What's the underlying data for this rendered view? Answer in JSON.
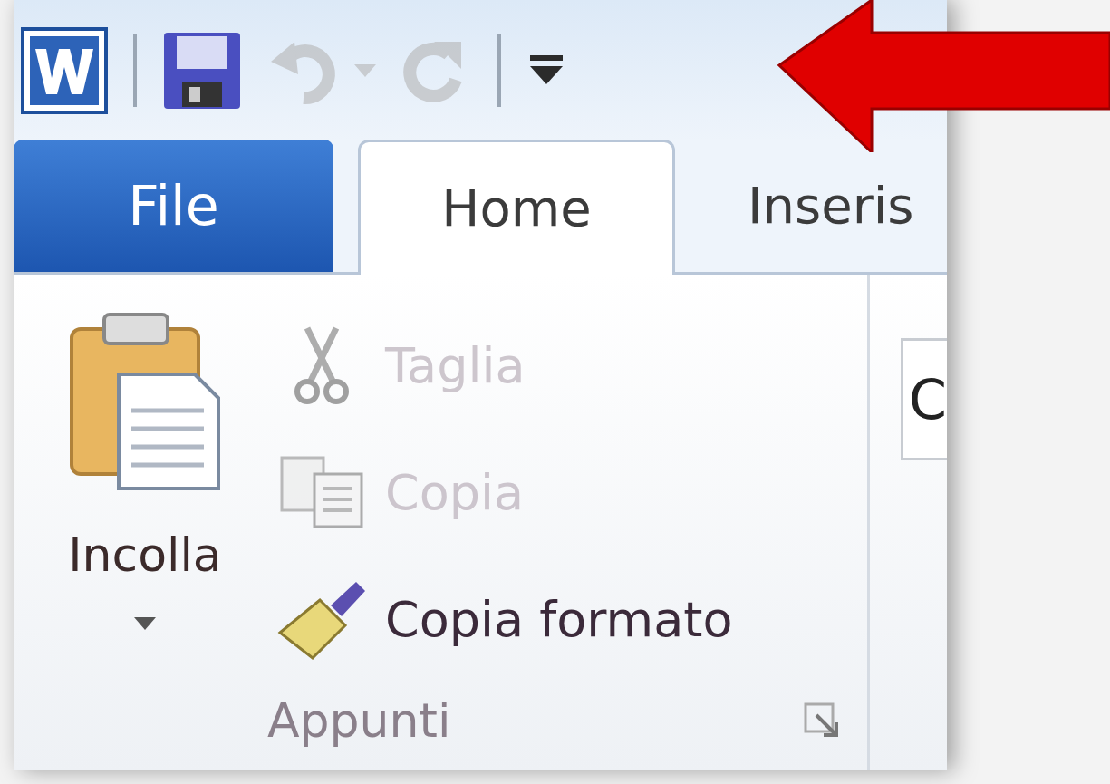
{
  "quick_access_toolbar": [
    {
      "kind": "save",
      "disabled": false
    },
    {
      "kind": "undo",
      "disabled": true
    },
    {
      "kind": "redo",
      "disabled": true
    },
    {
      "kind": "customize",
      "disabled": false
    }
  ],
  "tabs": [
    {
      "label": "File",
      "kind": "file",
      "selected": false
    },
    {
      "label": "Home",
      "kind": "tab",
      "selected": true
    },
    {
      "label": "Inseris",
      "kind": "tab",
      "selected": false
    }
  ],
  "ribbon": {
    "group": {
      "label": "Appunti",
      "large_button": {
        "label": "Incolla"
      },
      "small_buttons": [
        {
          "label": "Taglia",
          "kind": "scissors",
          "disabled": true
        },
        {
          "label": "Copia",
          "kind": "copy",
          "disabled": true
        },
        {
          "label": "Copia formato",
          "kind": "brush",
          "disabled": false
        }
      ]
    },
    "next_group": {
      "field_value": "C"
    }
  }
}
